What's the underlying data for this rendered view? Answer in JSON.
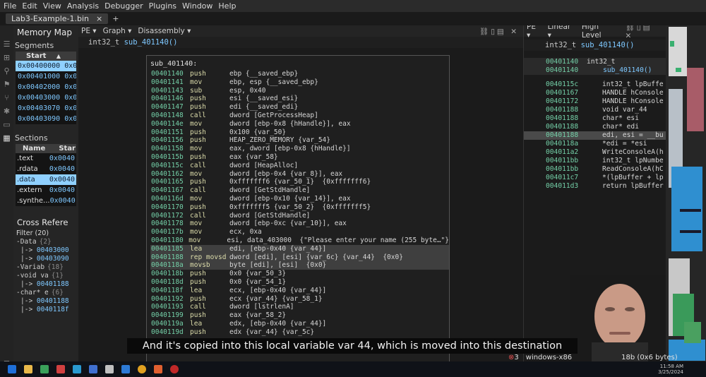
{
  "menubar": {
    "items": [
      "File",
      "Edit",
      "View",
      "Analysis",
      "Debugger",
      "Plugins",
      "Window",
      "Help"
    ]
  },
  "tabbar": {
    "tab_label": "Lab3-Example-1.bin",
    "close": "×",
    "add": "+"
  },
  "left": {
    "memory_map_title": "Memory Map",
    "segments_title": "Segments",
    "segments_header": "Start",
    "segments": [
      "0x00400000 0x00",
      "0x00401000 0x00",
      "0x00402000 0x00",
      "0x00403000 0x00",
      "0x00403070 0x00",
      "0x00403090 0x00"
    ],
    "sections_title": "Sections",
    "sections_header_name": "Name",
    "sections_header_start": "Star",
    "sections": [
      {
        "name": ".text",
        "start": "0x0040"
      },
      {
        "name": ".rdata",
        "start": "0x0040"
      },
      {
        "name": ".data",
        "start": "0x0040"
      },
      {
        "name": ".extern",
        "start": "0x0040"
      },
      {
        "name": ".synthe...",
        "start": "0x0040"
      }
    ],
    "xref_title": "Cross Refere",
    "xref_filter": "Filter (20)",
    "xrefs": [
      {
        "t": "-Data",
        "c": "{2}"
      },
      {
        "t": "|-> ",
        "a": "00403000"
      },
      {
        "t": "|-> ",
        "a": "00403090"
      },
      {
        "t": "-Variab",
        "c": "{18}"
      },
      {
        "t": "-void va",
        "c": "{1}"
      },
      {
        "t": "|-> ",
        "a": "00401188"
      },
      {
        "t": "-char* e",
        "c": "{6}"
      },
      {
        "t": "|-> ",
        "a": "00401188"
      },
      {
        "t": "|-> ",
        "a": "0040118f"
      }
    ]
  },
  "center": {
    "view_pe": "PE",
    "view_graph": "Graph",
    "view_disasm": "Disassembly",
    "signature_type": "int32_t",
    "signature_name": "sub_401140()",
    "block_header": "sub_401140:",
    "lines": [
      {
        "a": "00401140",
        "m": "push",
        "o": "ebp {__saved_ebp}"
      },
      {
        "a": "00401141",
        "m": "mov",
        "o": "ebp, esp {__saved_ebp}"
      },
      {
        "a": "00401143",
        "m": "sub",
        "o": "esp, 0x40"
      },
      {
        "a": "00401146",
        "m": "push",
        "o": "esi {__saved_esi}"
      },
      {
        "a": "00401147",
        "m": "push",
        "o": "edi {__saved_edi}"
      },
      {
        "a": "00401148",
        "m": "call",
        "o": "dword [GetProcessHeap]"
      },
      {
        "a": "0040114e",
        "m": "mov",
        "o": "dword [ebp-0x8 {hHandle}], eax"
      },
      {
        "a": "00401151",
        "m": "push",
        "o": "0x100 {var_50}"
      },
      {
        "a": "00401156",
        "m": "push",
        "o": "HEAP_ZERO_MEMORY {var_54}"
      },
      {
        "a": "00401158",
        "m": "mov",
        "o": "eax, dword [ebp-0x8 {hHandle}]"
      },
      {
        "a": "0040115b",
        "m": "push",
        "o": "eax {var_58}"
      },
      {
        "a": "0040115c",
        "m": "call",
        "o": "dword [HeapAlloc]"
      },
      {
        "a": "00401162",
        "m": "mov",
        "o": "dword [ebp-0x4 {var_8}], eax"
      },
      {
        "a": "00401165",
        "m": "push",
        "o": "0xfffffff6 {var_50_1}  {0xfffffff6}"
      },
      {
        "a": "00401167",
        "m": "call",
        "o": "dword [GetStdHandle]"
      },
      {
        "a": "0040116d",
        "m": "mov",
        "o": "dword [ebp-0x10 {var_14}], eax"
      },
      {
        "a": "00401170",
        "m": "push",
        "o": "0xfffffff5 {var_50_2}  {0xfffffff5}"
      },
      {
        "a": "00401172",
        "m": "call",
        "o": "dword [GetStdHandle]"
      },
      {
        "a": "00401178",
        "m": "mov",
        "o": "dword [ebp-0xc {var_10}], eax"
      },
      {
        "a": "0040117b",
        "m": "mov",
        "o": "ecx, 0xa"
      },
      {
        "a": "00401180",
        "m": "mov",
        "o": "esi, data_403000  {\"Please enter your name (255 byte…\"}"
      },
      {
        "a": "00401185",
        "m": "lea",
        "o": "edi, [ebp-0x40 {var_44}]"
      },
      {
        "a": "00401188",
        "m": "rep movsd",
        "o": "dword [edi], [esi] {var_6c} {var_44}  {0x0}"
      },
      {
        "a": "0040118a",
        "m": "movsb",
        "o": "byte [edi], [esi]  {0x0}"
      },
      {
        "a": "0040118b",
        "m": "push",
        "o": "0x0 {var_50_3}"
      },
      {
        "a": "0040118d",
        "m": "push",
        "o": "0x0 {var_54_1}"
      },
      {
        "a": "0040118f",
        "m": "lea",
        "o": "ecx, [ebp-0x40 {var_44}]"
      },
      {
        "a": "00401192",
        "m": "push",
        "o": "ecx {var_44} {var_58_1}"
      },
      {
        "a": "00401193",
        "m": "call",
        "o": "dword [lstrlenA]"
      },
      {
        "a": "00401199",
        "m": "push",
        "o": "eax {var_58_2}"
      },
      {
        "a": "0040119a",
        "m": "lea",
        "o": "edx, [ebp-0x40 {var_44}]"
      },
      {
        "a": "0040119d",
        "m": "push",
        "o": "edx {var_44} {var_5c}"
      }
    ]
  },
  "right": {
    "view_pe": "PE",
    "view_linear": "Linear",
    "view_hl": "High Level",
    "signature_type": "int32_t",
    "signature_name": "sub_401140()",
    "top_lines": [
      {
        "a": "00401140",
        "t": "int32_t"
      },
      {
        "a": "00401140",
        "t": "    sub_401140()"
      }
    ],
    "lines": [
      {
        "a": "0040115c",
        "t": "int32_t lpBuffe"
      },
      {
        "a": "00401167",
        "t": "HANDLE hConsole"
      },
      {
        "a": "00401172",
        "t": "HANDLE hConsole"
      },
      {
        "a": "00401188",
        "t": "void var_44"
      },
      {
        "a": "00401188",
        "t": "char* esi"
      },
      {
        "a": "00401188",
        "t": "char* edi"
      },
      {
        "a": "00401188",
        "t": "edi, esi = __bu"
      },
      {
        "a": "0040118a",
        "t": "*edi = *esi"
      },
      {
        "a": "004011a2",
        "t": "WriteConsoleA(h"
      },
      {
        "a": "004011bb",
        "t": "int32_t lpNumbe"
      },
      {
        "a": "004011bb",
        "t": "ReadConsoleA(hC"
      },
      {
        "a": "004011c7",
        "t": "*(lpBuffer + lp"
      },
      {
        "a": "004011d3",
        "t": "return lpBuffer"
      }
    ]
  },
  "caption": "And it's copied into this local variable var 44, which is moved into this destination",
  "status": {
    "errors": "3",
    "platform": "windows-x86",
    "size": "18b (0x6 bytes)",
    "time": "11:58 AM",
    "date": "3/25/2024"
  },
  "colors": {
    "accent": "#8fd0ff",
    "address": "#74d0a8",
    "mnemonic": "#dcdcaa"
  }
}
